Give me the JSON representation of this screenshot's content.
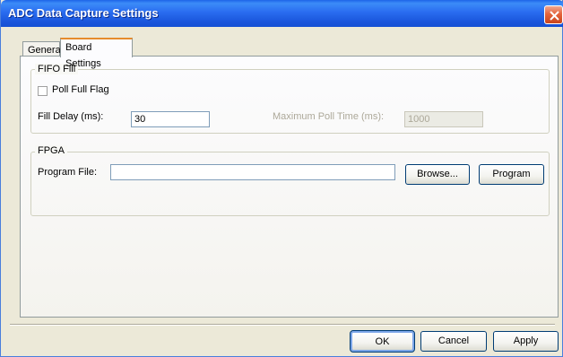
{
  "window": {
    "title": "ADC Data Capture Settings"
  },
  "tabs": [
    {
      "label": "General"
    },
    {
      "label": "Board Settings"
    }
  ],
  "fifo": {
    "group_label": "FIFO Fill",
    "poll_full_flag_label": "Poll Full Flag",
    "poll_full_flag_checked": false,
    "fill_delay_label": "Fill Delay (ms):",
    "fill_delay_value": "30",
    "max_poll_label": "Maximum Poll Time (ms):",
    "max_poll_value": "1000"
  },
  "fpga": {
    "group_label": "FPGA",
    "program_file_label": "Program File:",
    "program_file_value": "",
    "browse_label": "Browse...",
    "program_label": "Program"
  },
  "footer": {
    "ok_label": "OK",
    "cancel_label": "Cancel",
    "apply_label": "Apply"
  },
  "colors": {
    "titlebar": "#2a6cf0",
    "dialog_bg": "#ece9d8",
    "close_button": "#e4643c",
    "active_tab_accent": "#e68b2c"
  }
}
